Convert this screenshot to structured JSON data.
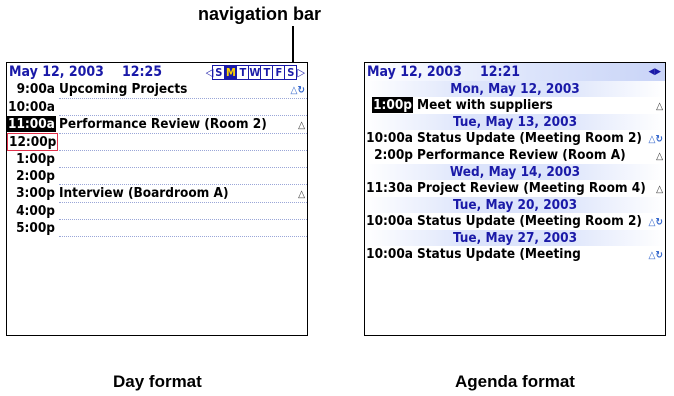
{
  "annotation": {
    "navigation_bar_label": "navigation bar"
  },
  "captions": {
    "day": "Day format",
    "agenda": "Agenda format"
  },
  "day_view": {
    "header": {
      "date": "May 12, 2003",
      "time": "12:25"
    },
    "week": [
      "S",
      "M",
      "T",
      "W",
      "T",
      "F",
      "S"
    ],
    "selected_day_index": 1,
    "rows": [
      {
        "time": "9:00a",
        "text": "Upcoming Projects",
        "icon": "alarm-recur"
      },
      {
        "time": "10:00a",
        "text": ""
      },
      {
        "time": "11:00a",
        "text": "Performance Review (Room 2)",
        "icon": "alarm",
        "highlight": true
      },
      {
        "time": "12:00p",
        "text": "",
        "selected": true
      },
      {
        "time": "1:00p",
        "text": ""
      },
      {
        "time": "2:00p",
        "text": ""
      },
      {
        "time": "3:00p",
        "text": "Interview (Boardroom A)",
        "icon": "alarm"
      },
      {
        "time": "4:00p",
        "text": ""
      },
      {
        "time": "5:00p",
        "text": ""
      }
    ]
  },
  "agenda_view": {
    "header": {
      "date": "May 12, 2003",
      "time": "12:21"
    },
    "groups": [
      {
        "date": "Mon, May 12, 2003",
        "items": [
          {
            "time": "1:00p",
            "text": "Meet with suppliers",
            "icon": "alarm",
            "highlight": true
          }
        ]
      },
      {
        "date": "Tue, May 13, 2003",
        "items": [
          {
            "time": "10:00a",
            "text": "Status Update (Meeting Room 2)",
            "icon": "alarm-recur"
          },
          {
            "time": "2:00p",
            "text": "Performance Review (Room A)",
            "icon": "alarm"
          }
        ]
      },
      {
        "date": "Wed, May 14, 2003",
        "items": [
          {
            "time": "11:30a",
            "text": "Project Review (Meeting Room 4)",
            "icon": "alarm"
          }
        ]
      },
      {
        "date": "Tue, May 20, 2003",
        "items": [
          {
            "time": "10:00a",
            "text": "Status Update (Meeting Room 2)",
            "icon": "alarm-recur"
          }
        ]
      },
      {
        "date": "Tue, May 27, 2003",
        "items": [
          {
            "time": "10:00a",
            "text": "Status Update (Meeting",
            "icon": "alarm-recur"
          }
        ]
      }
    ]
  }
}
